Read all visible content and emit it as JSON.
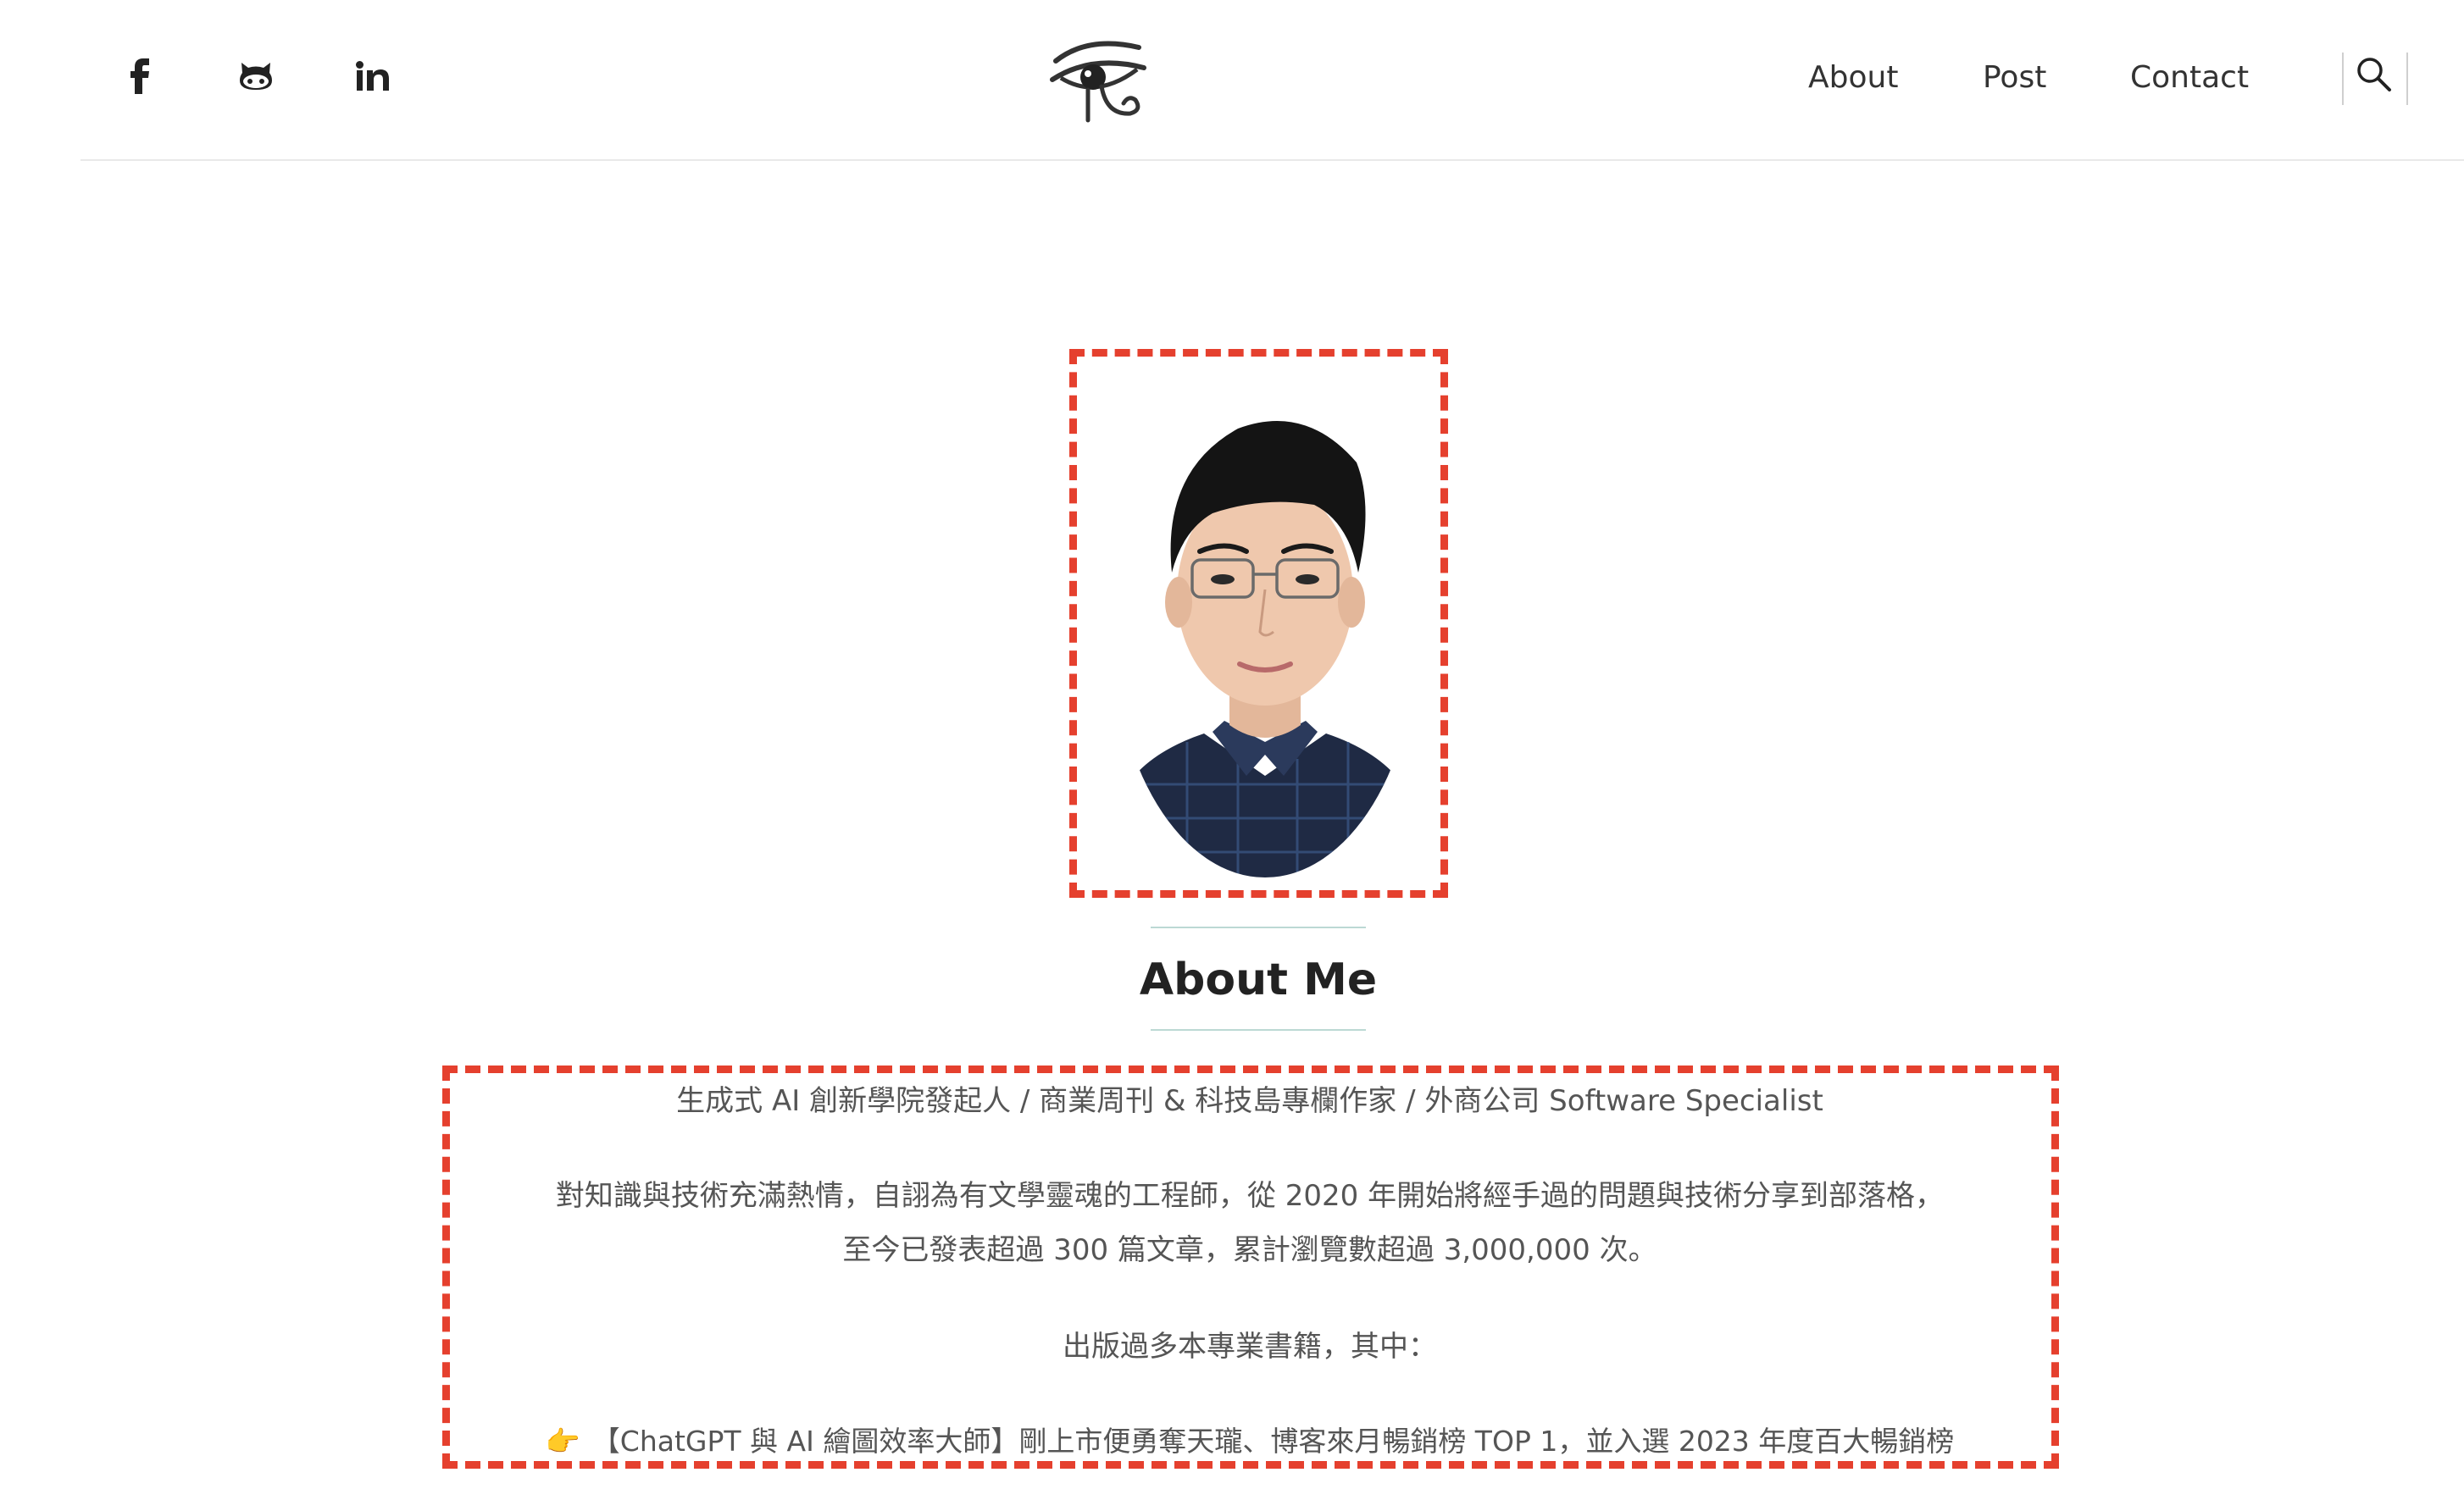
{
  "header": {
    "social": [
      {
        "name": "facebook-icon"
      },
      {
        "name": "github-icon"
      },
      {
        "name": "linkedin-icon"
      }
    ],
    "nav": {
      "about": "About",
      "post": "Post",
      "contact": "Contact"
    }
  },
  "profile": {
    "title": "About Me"
  },
  "bio": {
    "role": "生成式 AI 創新學院發起人 / 商業周刊 & 科技島專欄作家 / 外商公司 Software Specialist",
    "intro_line1": "對知識與技術充滿熱情，自詡為有文學靈魂的工程師，從 2020 年開始將經手過的問題與技術分享到部落格，",
    "intro_line2": "至今已發表超過 300 篇文章，累計瀏覽數超過 3,000,000 次。",
    "books_intro": "出版過多本專業書籍，其中：",
    "book1_icon": "👉",
    "book1": "【ChatGPT 與 AI 繪圖效率大師】剛上市便勇奪天瓏、博客來月暢銷榜 TOP 1，並入選 2023 年度百大暢銷榜"
  },
  "colors": {
    "highlight_dash": "#e5402e",
    "title_rule": "#bcd9d4",
    "accent": "#2a9d8f"
  }
}
